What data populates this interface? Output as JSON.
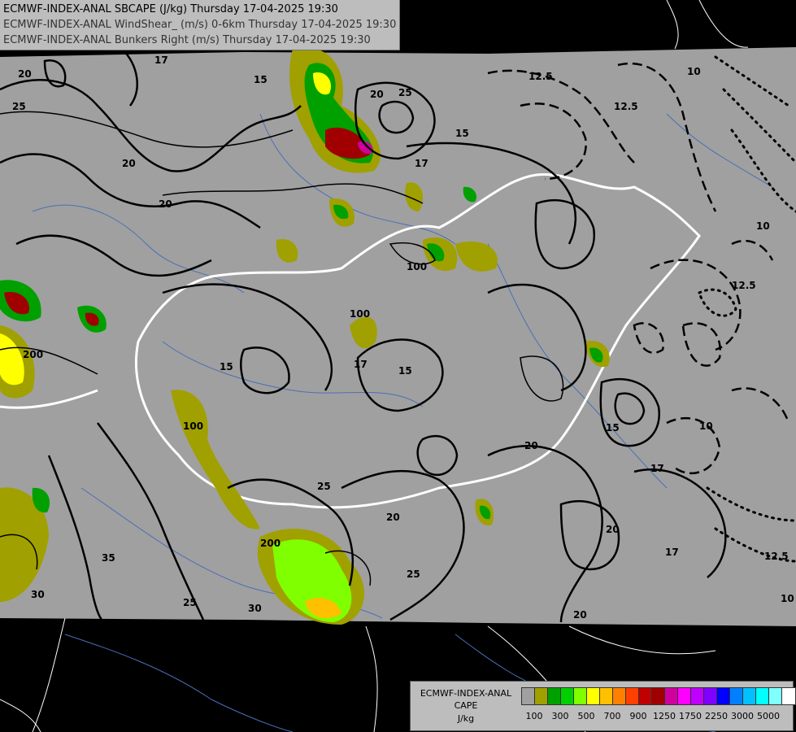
{
  "header": {
    "lines": [
      {
        "text": "ECMWF-INDEX-ANAL SBCAPE (J/kg) Thursday 17-04-2025 19:30",
        "color": "#000000"
      },
      {
        "text": "ECMWF-INDEX-ANAL WindShear_ (m/s) 0-6km Thursday 17-04-2025 19:30",
        "color": "#333333"
      },
      {
        "text": "ECMWF-INDEX-ANAL Bunkers Right (m/s) Thursday 17-04-2025 19:30",
        "color": "#333333"
      }
    ]
  },
  "legend": {
    "title_line1": "ECMWF-INDEX-ANAL",
    "title_line2": "CAPE",
    "title_line3": "J/kg",
    "colors": [
      "#a0a0a0",
      "#a0a000",
      "#00a000",
      "#00d000",
      "#80ff00",
      "#ffff00",
      "#ffc000",
      "#ff8000",
      "#ff4000",
      "#c00000",
      "#a00000",
      "#d000a0",
      "#ff00ff",
      "#c000ff",
      "#8000ff",
      "#0000ff",
      "#0080ff",
      "#00c0ff",
      "#00ffff",
      "#80ffff",
      "#ffffff"
    ],
    "tick_labels": [
      "100",
      "300",
      "500",
      "700",
      "900",
      "1250",
      "1750",
      "2250",
      "3000",
      "5000"
    ]
  },
  "map": {
    "contour_labels": [
      {
        "text": "20"
      },
      {
        "text": "17"
      },
      {
        "text": "15"
      },
      {
        "text": "25"
      },
      {
        "text": "20"
      },
      {
        "text": "17"
      },
      {
        "text": "15"
      },
      {
        "text": "12.5"
      },
      {
        "text": "10"
      },
      {
        "text": "12.5"
      },
      {
        "text": "12.5"
      },
      {
        "text": "10"
      },
      {
        "text": "25"
      },
      {
        "text": "20"
      },
      {
        "text": "20"
      },
      {
        "text": "100"
      },
      {
        "text": "100"
      },
      {
        "text": "15"
      },
      {
        "text": "17"
      },
      {
        "text": "15"
      },
      {
        "text": "20"
      },
      {
        "text": "10"
      },
      {
        "text": "17"
      },
      {
        "text": "25"
      },
      {
        "text": "20"
      },
      {
        "text": "100"
      },
      {
        "text": "200"
      },
      {
        "text": "30"
      },
      {
        "text": "25"
      },
      {
        "text": "30"
      },
      {
        "text": "35"
      },
      {
        "text": "20"
      },
      {
        "text": "17"
      },
      {
        "text": "12.5"
      },
      {
        "text": "10"
      },
      {
        "text": "20"
      },
      {
        "text": "25"
      },
      {
        "text": "15"
      },
      {
        "text": "200"
      }
    ],
    "colors": {
      "background": "#000000",
      "domain": "#a0a0a0",
      "border": "#ffffff",
      "river": "#4a6fb5",
      "contour": "#000000"
    }
  }
}
